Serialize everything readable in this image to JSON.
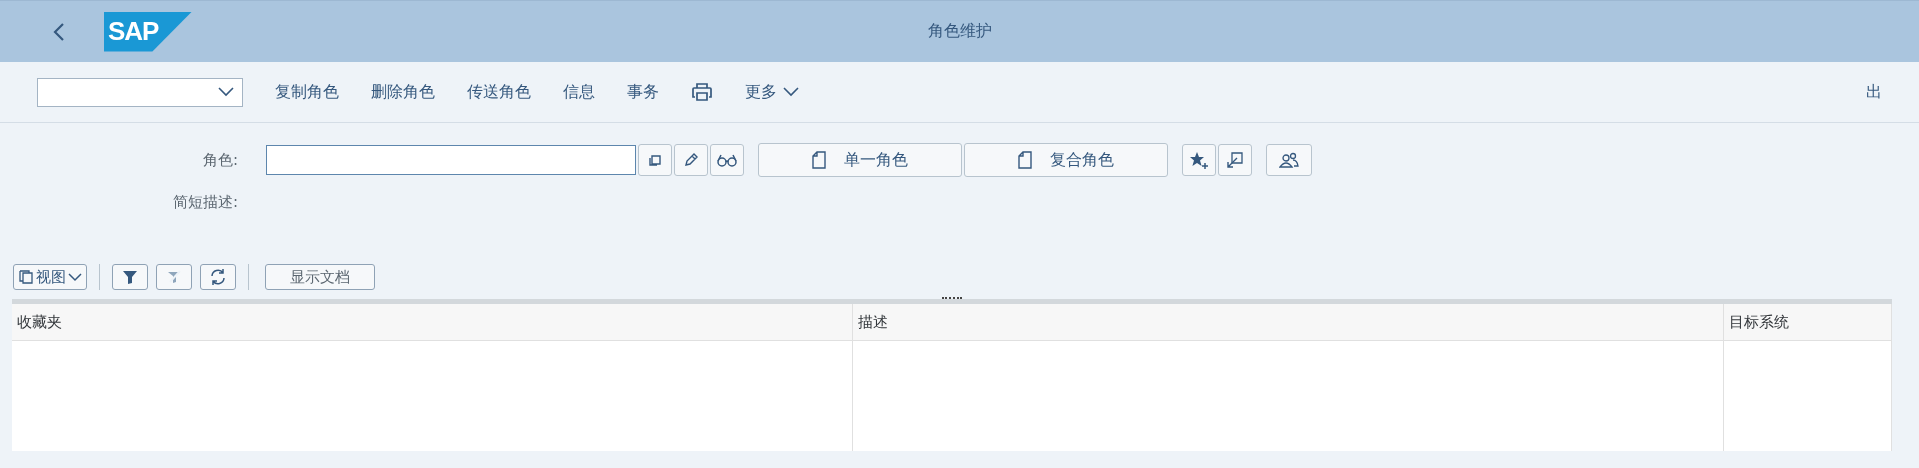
{
  "header": {
    "logo": "SAP",
    "title": "角色维护"
  },
  "toolbar": {
    "items": [
      {
        "kind": "dropdown",
        "value": ""
      },
      {
        "kind": "text",
        "label": "复制角色"
      },
      {
        "kind": "text",
        "label": "删除角色"
      },
      {
        "kind": "text",
        "label": "传送角色"
      },
      {
        "kind": "text",
        "label": "信息"
      },
      {
        "kind": "text",
        "label": "事务"
      },
      {
        "kind": "print"
      },
      {
        "kind": "more",
        "label": "更多"
      }
    ],
    "exit": "出"
  },
  "form": {
    "role_label": "角色:",
    "desc_label": "简短描述:",
    "buttons": [
      {
        "kind": "doc",
        "label": "单一角色"
      },
      {
        "kind": "doc",
        "label": "复合角色"
      }
    ]
  },
  "grid_toolbar": {
    "view": "视图",
    "buttons": [
      {
        "kind": "filter",
        "disabled": false
      },
      {
        "kind": "filter-clear",
        "disabled": true
      },
      {
        "kind": "refresh",
        "disabled": false
      }
    ],
    "doc_button": "显示文档"
  },
  "table": {
    "columns": [
      "收藏夹",
      "描述",
      "目标系统"
    ]
  }
}
